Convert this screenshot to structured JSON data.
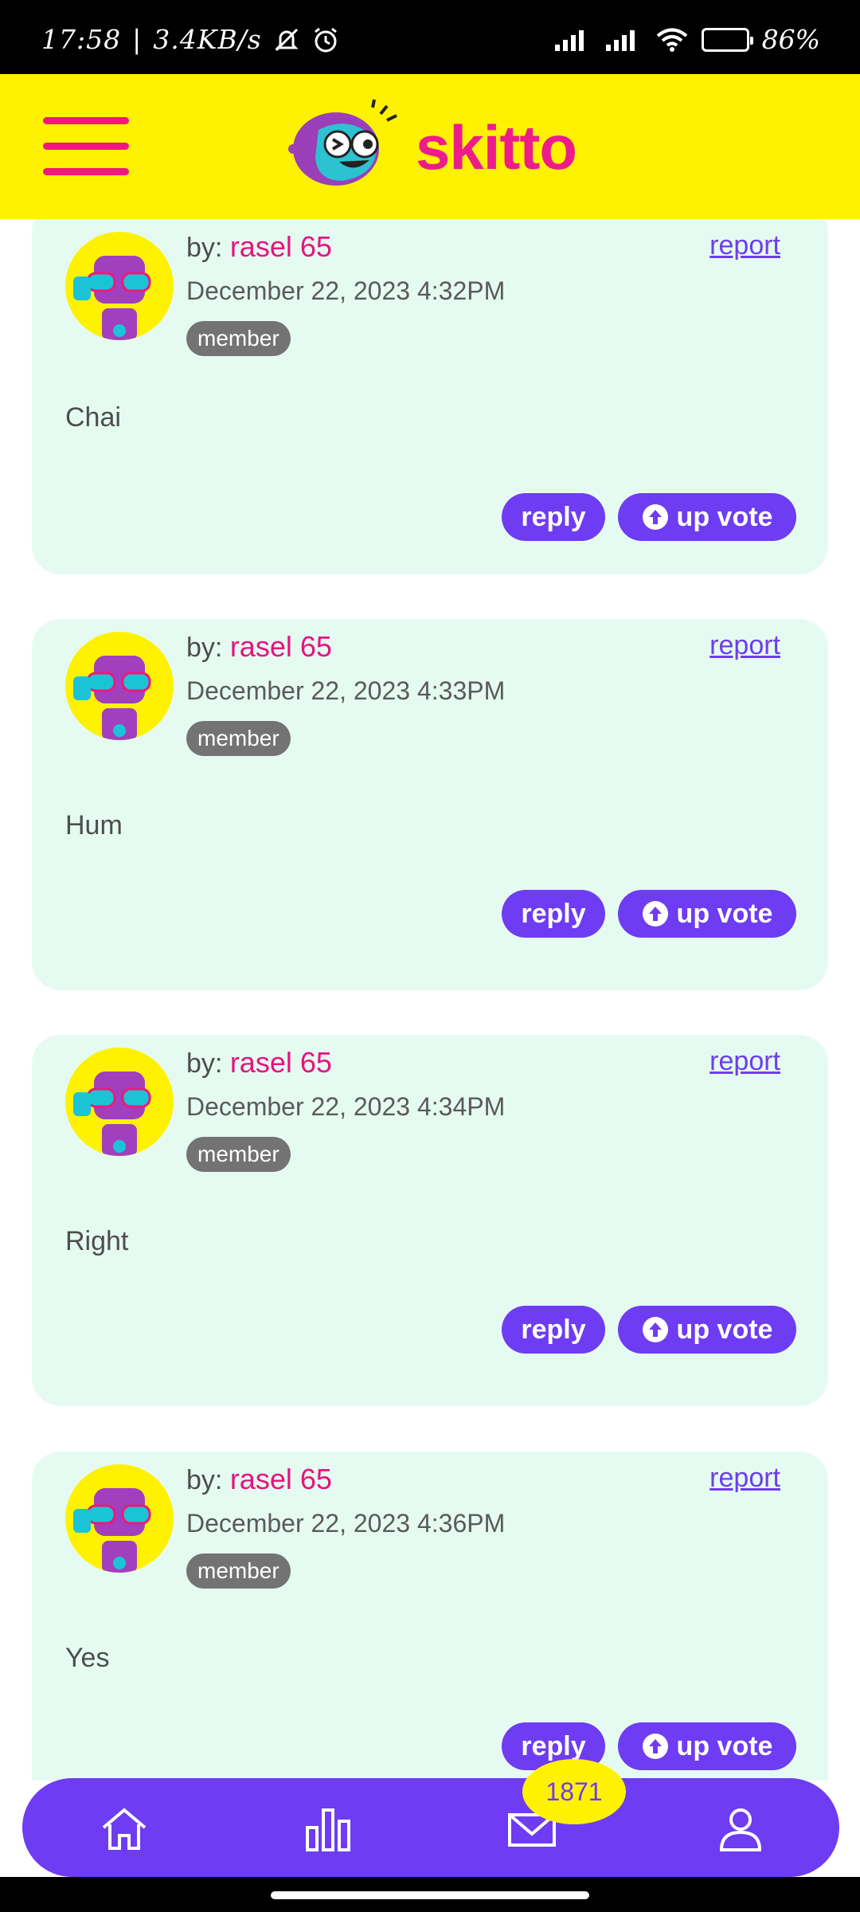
{
  "status_bar": {
    "time": "17:58",
    "speed": "3.4KB/s",
    "battery": "86%",
    "battery_level": 0.86
  },
  "header": {
    "logo_text": "skitto",
    "brand_color": "#ec1d8a",
    "header_color": "#fff200"
  },
  "comments": [
    {
      "by_label": "by:",
      "author": "rasel 65",
      "date": "December 22, 2023 4:32PM",
      "role": "member",
      "report_label": "report",
      "text": "Chai",
      "reply_label": "reply",
      "upvote_label": "up vote"
    },
    {
      "by_label": "by:",
      "author": "rasel 65",
      "date": "December 22, 2023 4:33PM",
      "role": "member",
      "report_label": "report",
      "text": "Hum",
      "reply_label": "reply",
      "upvote_label": "up vote"
    },
    {
      "by_label": "by:",
      "author": "rasel 65",
      "date": "December 22, 2023 4:34PM",
      "role": "member",
      "report_label": "report",
      "text": "Right",
      "reply_label": "reply",
      "upvote_label": "up vote"
    },
    {
      "by_label": "by:",
      "author": "rasel 65",
      "date": "December 22, 2023 4:36PM",
      "role": "member",
      "report_label": "report",
      "text": "Yes",
      "reply_label": "reply",
      "upvote_label": "up vote"
    }
  ],
  "bottom_nav": {
    "items": [
      {
        "icon": "home-icon"
      },
      {
        "icon": "bar-chart-icon"
      },
      {
        "icon": "mail-icon"
      },
      {
        "icon": "profile-icon"
      }
    ],
    "message_count": "1871",
    "accent": "#6e3cf2"
  }
}
